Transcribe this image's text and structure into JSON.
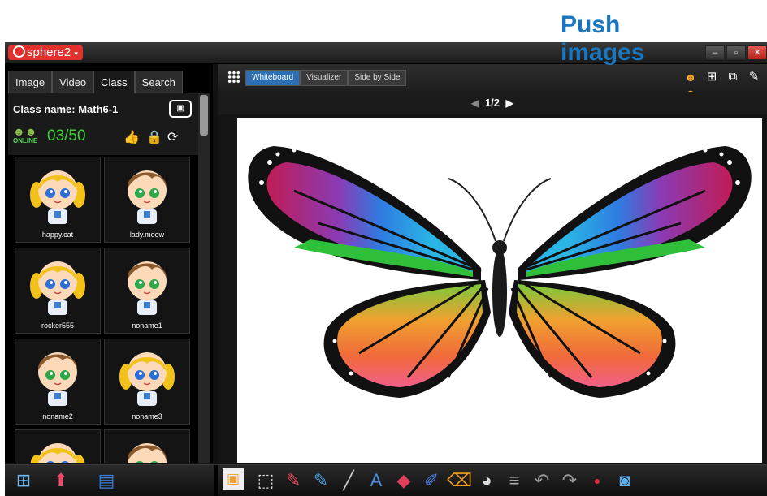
{
  "callout": {
    "line1": "Push",
    "line2": "images"
  },
  "app": {
    "title": "sphere2"
  },
  "window": {
    "minimize": "–",
    "maximize": "▫",
    "close": "✕"
  },
  "left_panel": {
    "tabs": [
      {
        "label": "Image"
      },
      {
        "label": "Video"
      },
      {
        "label": "Class"
      },
      {
        "label": "Search"
      }
    ],
    "active_tab": "Class",
    "class_name": "Class name: Math6-1",
    "online_label": "ONLINE",
    "online_count": "03/50",
    "students": [
      {
        "name": "happy.cat",
        "gender": "girl"
      },
      {
        "name": "lady.moew",
        "gender": "boy"
      },
      {
        "name": "rocker555",
        "gender": "girl"
      },
      {
        "name": "noname1",
        "gender": "boy"
      },
      {
        "name": "noname2",
        "gender": "boy"
      },
      {
        "name": "noname3",
        "gender": "girl"
      },
      {
        "name": "",
        "gender": "girl"
      },
      {
        "name": "",
        "gender": "boy"
      }
    ]
  },
  "right_panel": {
    "modes": [
      {
        "label": "Whiteboard"
      },
      {
        "label": "Visualizer"
      },
      {
        "label": "Side by Side"
      }
    ],
    "active_mode": "Whiteboard",
    "page_indicator": "1/2",
    "top_icons": [
      "push-images-icon",
      "new-page-icon",
      "add-page-icon",
      "edit-page-icon"
    ]
  },
  "bottom_tools": {
    "left": [
      "layout-icon",
      "push-up-arrow-icon",
      "document-icon"
    ],
    "right": [
      "select-mode-icon",
      "marquee-select-icon",
      "red-pen-icon",
      "blue-pen-icon",
      "line-icon",
      "text-icon",
      "shapes-icon",
      "highlighter-icon",
      "eraser-icon",
      "color-palette-icon",
      "line-width-icon",
      "undo-icon",
      "redo-icon",
      "record-icon",
      "camera-icon"
    ],
    "text_tool_label": "A"
  },
  "colors": {
    "accent_blue": "#1976c0",
    "logo_red": "#e0312c",
    "online_green": "#3fcf3f",
    "active_mode": "#2c6fb3"
  }
}
